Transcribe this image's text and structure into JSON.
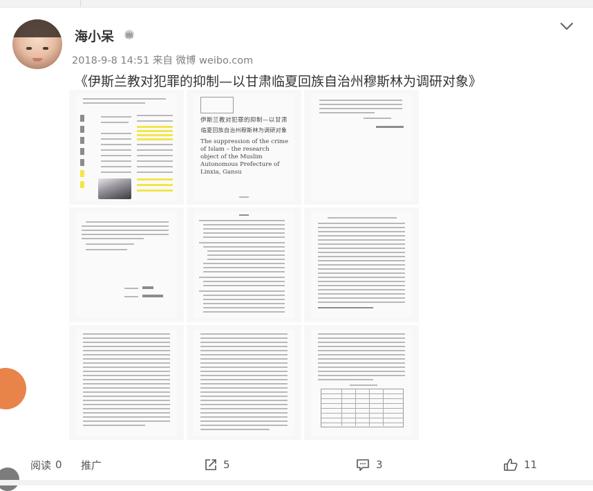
{
  "post": {
    "author": "海小呆",
    "date": "2018-9-8 14:51",
    "source_prefix": "来自",
    "source": "微博 weibo.com",
    "text": "《伊斯兰教对犯罪的抑制—以甘肃临夏回族自治州穆斯林为调研对象》"
  },
  "images": {
    "thumb2": {
      "title_cn_1": "伊斯兰教对犯罪的抑制—以甘肃",
      "title_cn_2": "临夏回族自治州穆斯林为调研对象",
      "title_en": "The suppression of the crime of Islam – the research object of the Muslim Autonomous Prefecture of Linxia, Gansu"
    }
  },
  "footer": {
    "read_label": "阅读",
    "read_count": "0",
    "promote_label": "推广",
    "share_count": "5",
    "comment_count": "3",
    "like_count": "11"
  },
  "icons": {
    "vip": "crown-badge-icon",
    "collapse": "chevron-down-icon",
    "share": "share-icon",
    "comment": "comment-icon",
    "like": "thumbs-up-icon"
  },
  "colors": {
    "meta_text": "#808080",
    "highlight": "#f2e64a",
    "side_avatar": "#e8844a"
  }
}
